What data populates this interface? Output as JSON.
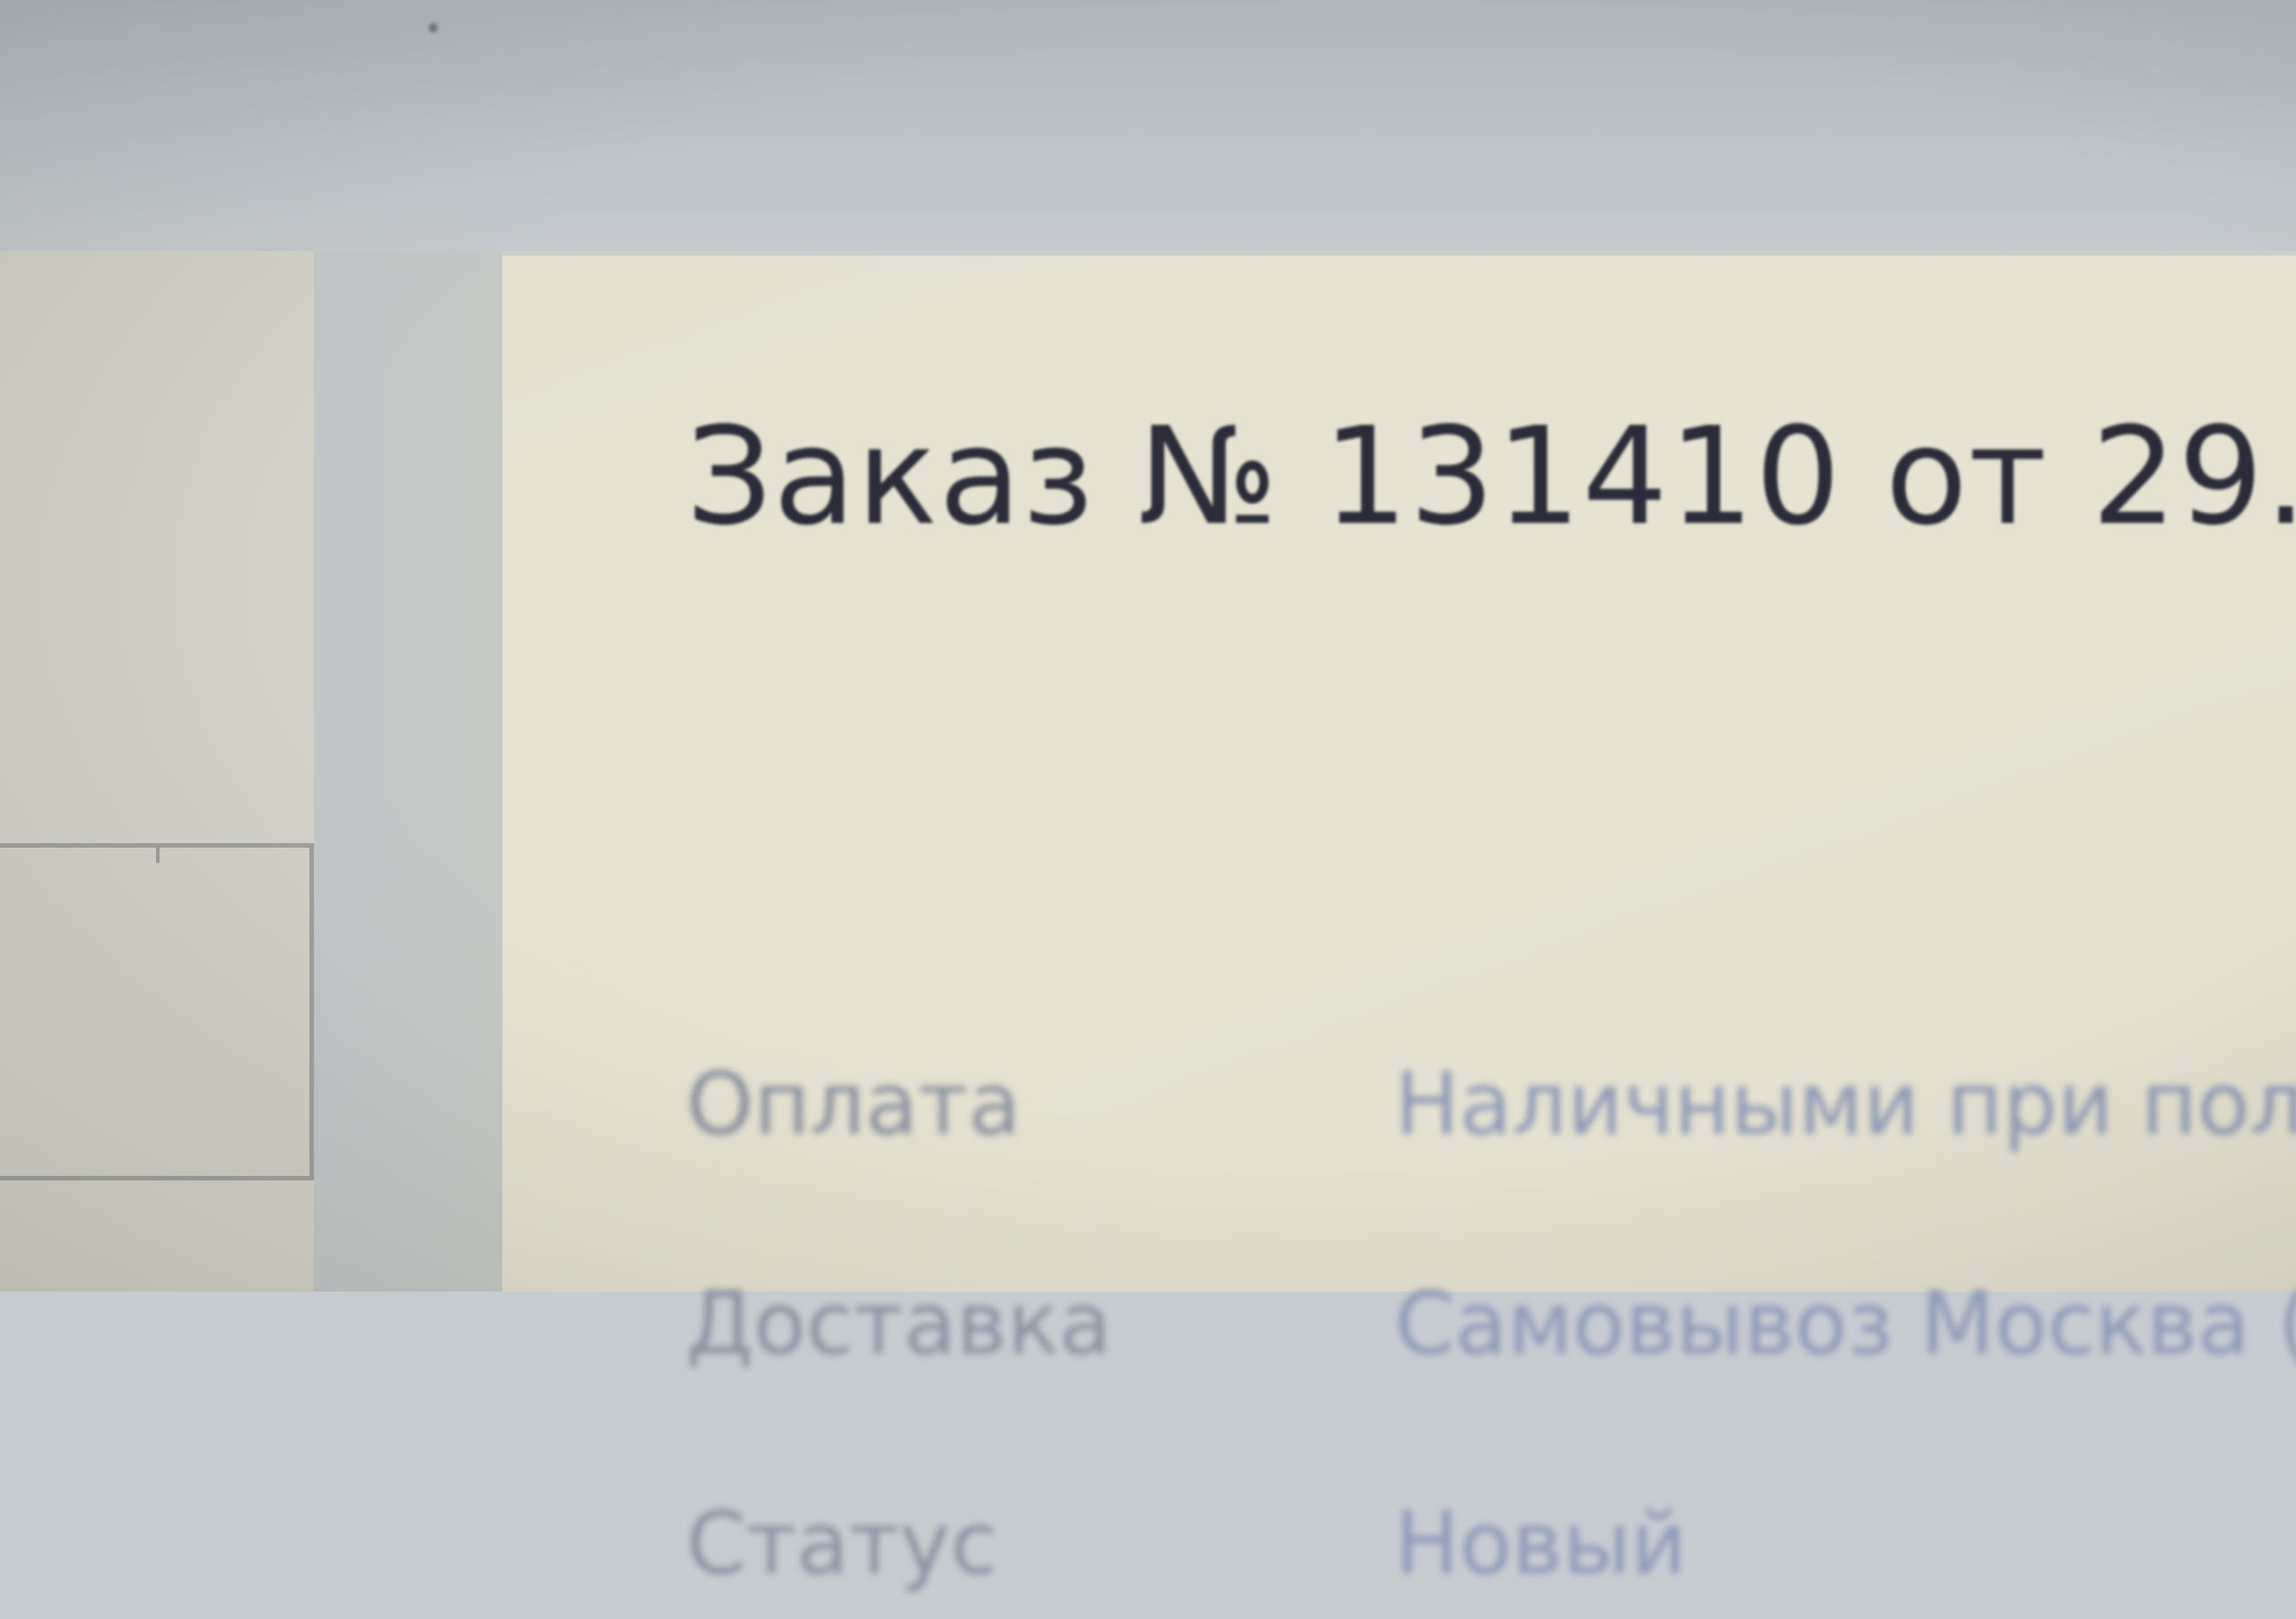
{
  "order": {
    "title": "Заказ № 131410 от 29.",
    "fields": [
      {
        "label": "Оплата",
        "value": "Наличными при пол"
      },
      {
        "label": "Доставка",
        "value": "Самовывоз Москва ("
      },
      {
        "label": "Статус",
        "value": "Новый"
      }
    ]
  },
  "colors": {
    "title_text": "#2b2b39",
    "label_text": "#8e92a1",
    "value_text": "#8f9ab7",
    "panel_bg": "#e4e1d1"
  }
}
